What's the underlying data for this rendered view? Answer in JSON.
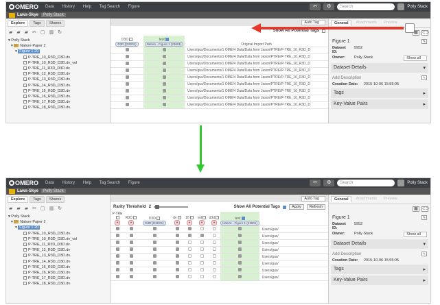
{
  "app": {
    "logo": "OMERO",
    "nav": [
      "Data",
      "History",
      "Help",
      "Tag Search",
      "Figure"
    ],
    "search_placeholder": "Search",
    "user": "Polly Stack"
  },
  "group": {
    "name": "Laws-Skye",
    "owner": "Polly Stack"
  },
  "left_panel": {
    "tabs": [
      "Explore",
      "Tags",
      "Shares"
    ],
    "tree_root": "Polly Stack",
    "project": "Nature Paper",
    "project_count": "2",
    "dataset": "Figure 1",
    "dataset_count": "20",
    "images": [
      "P-TRE_10_R3D_D3D.dv",
      "P-TRE_10_R3D_D3D.dv_vol",
      "P-TRE_11_R3D_D3D.dv",
      "P-TRE_12_R3D_D3D.dv",
      "P-TRE_13_R3D_D3D.dv",
      "P-TRE_14_R3D_D3D.dv",
      "P-TRE_15_R3D_D3D.dv",
      "P-TRE_16_R3D_D3D.dv",
      "P-TRE_17_R3D_D3D.dv",
      "P-TRE_18_R3D_D3D.dv"
    ]
  },
  "center": {
    "dropdown": "Auto Tag",
    "show_all_label": "Show All Potential Tags",
    "rarity_label": "Rarity Threshold",
    "rarity_value": "2",
    "apply_label": "Apply",
    "refresh_label": "Refresh",
    "path_header": "Original Import Path",
    "path_value": "Users/gus/Documents/1 OME/4 Data/Data from Jason/PTRE/P-TRE_10_R3D_D",
    "path_short": "Users/gus/",
    "top_columns": [
      {
        "label": "D3D",
        "pill": "D3D (D3D01)"
      },
      {
        "label": "test",
        "pill": "Nature - Figure 1 (23601)"
      }
    ],
    "bottom_columns": [
      {
        "label": "P-TRE",
        "pill": ""
      },
      {
        "label": "R3D",
        "pill": ""
      },
      {
        "label": "D3D",
        "pill": "D3D (D3D01)"
      },
      {
        "label": "dv",
        "pill": ""
      },
      {
        "label": "10",
        "pill": ""
      },
      {
        "label": "vol",
        "pill": ""
      },
      {
        "label": "d3d",
        "pill": ""
      },
      {
        "label": "test",
        "pill": "Nature - Figure 1 (23601)"
      }
    ]
  },
  "right_panel": {
    "tabs": [
      "General",
      "Attachments",
      "Preview"
    ],
    "title": "Figure 1",
    "dataset_id_label": "Dataset ID:",
    "dataset_id": "5952",
    "owner_label": "Owner:",
    "owner": "Polly Stack",
    "show_all": "Show all",
    "details": "Dataset Details",
    "add_description": "Add Description",
    "creation_label": "Creation Date:",
    "creation_date": "2015-10-06 15:55:05",
    "tags": "Tags",
    "kv_pairs": "Key-Value Pairs"
  }
}
